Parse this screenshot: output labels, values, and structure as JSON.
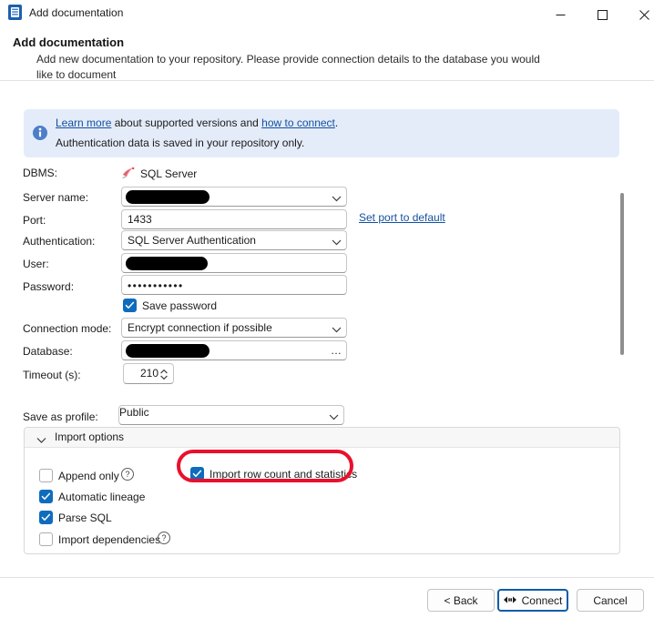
{
  "window": {
    "title": "Add documentation",
    "app_icon": "document-icon",
    "controls": {
      "minimize": "minimize-icon",
      "maximize": "maximize-icon",
      "close": "close-icon"
    }
  },
  "header": {
    "title": "Add documentation",
    "subtitle": "Add new documentation to your repository. Please provide connection details to the database you would like to document"
  },
  "info_banner": {
    "icon": "info-icon",
    "line1_link1": "Learn more",
    "line1_mid": " about supported versions and ",
    "line1_link2": "how to connect",
    "line1_end": ".",
    "line2": "Authentication data is saved in your repository only."
  },
  "form": {
    "dbms": {
      "label": "DBMS:",
      "value": "SQL Server",
      "icon": "sql-server-icon"
    },
    "server_name": {
      "label": "Server name:",
      "value": "",
      "redacted": true,
      "redact_width": 92
    },
    "port": {
      "label": "Port:",
      "value": "1433"
    },
    "set_port_link": "Set port to default",
    "authentication": {
      "label": "Authentication:",
      "value": "SQL Server Authentication"
    },
    "user": {
      "label": "User:",
      "value": "",
      "redacted": true,
      "redact_width": 90
    },
    "password": {
      "label": "Password:",
      "value": "•••••••••••"
    },
    "save_password": {
      "label": "Save password",
      "checked": true
    },
    "connection_mode": {
      "label": "Connection mode:",
      "value": "Encrypt connection if possible"
    },
    "database": {
      "label": "Database:",
      "value": "",
      "redacted": true,
      "redact_width": 92,
      "browse": "…"
    },
    "timeout": {
      "label": "Timeout (s):",
      "value": "210"
    },
    "save_as_profile": {
      "label": "Save as profile:",
      "value": "Public"
    }
  },
  "import_options": {
    "title": "Import options",
    "expanded": true,
    "items": [
      {
        "label": "Append only",
        "checked": false,
        "help": "?"
      },
      {
        "label": "Automatic lineage",
        "checked": true
      },
      {
        "label": "Parse SQL",
        "checked": true
      },
      {
        "label": "Import dependencies",
        "checked": false,
        "help": "?"
      },
      {
        "label": "Import row count and statistics",
        "checked": true,
        "highlighted": true
      }
    ]
  },
  "footer": {
    "back": "< Back",
    "connect": "Connect",
    "connect_icon": "connect-plug-icon",
    "cancel": "Cancel"
  },
  "colors": {
    "accent": "#0f6cbd",
    "link": "#14509e",
    "banner_bg": "#e4ecf9",
    "annotation": "#e8112d",
    "focus_border": "#0f5ca8"
  }
}
